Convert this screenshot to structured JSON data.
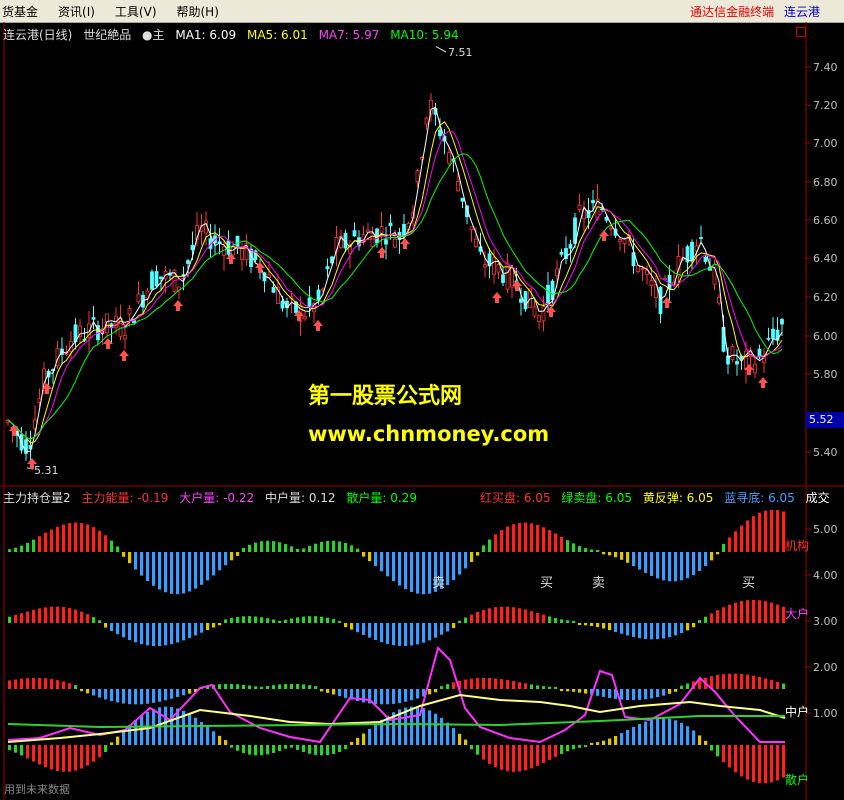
{
  "menu": {
    "items": [
      "货基金",
      "资讯(I)",
      "工具(V)",
      "帮助(H)"
    ],
    "brand_part1": "通达信金融终端",
    "brand_part2": "连云港"
  },
  "kline": {
    "symbol": "连云港(日线)",
    "formula": "世纪絶品",
    "main_tag": "●主",
    "ma1": "MA1: 6.09",
    "ma5": "MA5: 6.01",
    "ma7": "MA7: 5.97",
    "ma10": "MA10: 5.94",
    "high_tag": "7.51",
    "low_tag": "5.31",
    "current_price": "5.52",
    "y_ticks": [
      "7.40",
      "7.20",
      "7.00",
      "6.80",
      "6.60",
      "6.40",
      "6.20",
      "6.00",
      "5.80",
      "5.40"
    ]
  },
  "indicator": {
    "name": "主力持仓量2",
    "main": "主力能量: -0.19",
    "big": "大户量: -0.22",
    "mid": "中户量: 0.12",
    "retail": "散户量: 0.29",
    "red_buy": "红买盘: 6.05",
    "green_sell": "绿卖盘: 6.05",
    "yellow": "黄反弹: 6.05",
    "blue": "蓝寻底: 6.05",
    "volume": "成交",
    "y_ticks": [
      "5.00",
      "4.00",
      "3.00",
      "2.00",
      "1.00"
    ],
    "lane_labels": [
      "机构",
      "大户",
      "中户",
      "散户"
    ],
    "signals": [
      "卖",
      "买",
      "卖",
      "买"
    ]
  },
  "watermark": {
    "line1": "第一股票公式网",
    "line2": "www.chnmoney.com"
  },
  "footer": "用到未来数据",
  "colors": {
    "up": "#ff3232",
    "down": "#54ffff",
    "ma1": "#ffffff",
    "ma5": "#ffff00",
    "ma7": "#ff00ff",
    "ma10": "#00ff00",
    "bar_red": "#ff2020",
    "bar_green": "#30d030",
    "bar_yellow": "#e0c800",
    "bar_blue": "#3c9cff"
  }
}
